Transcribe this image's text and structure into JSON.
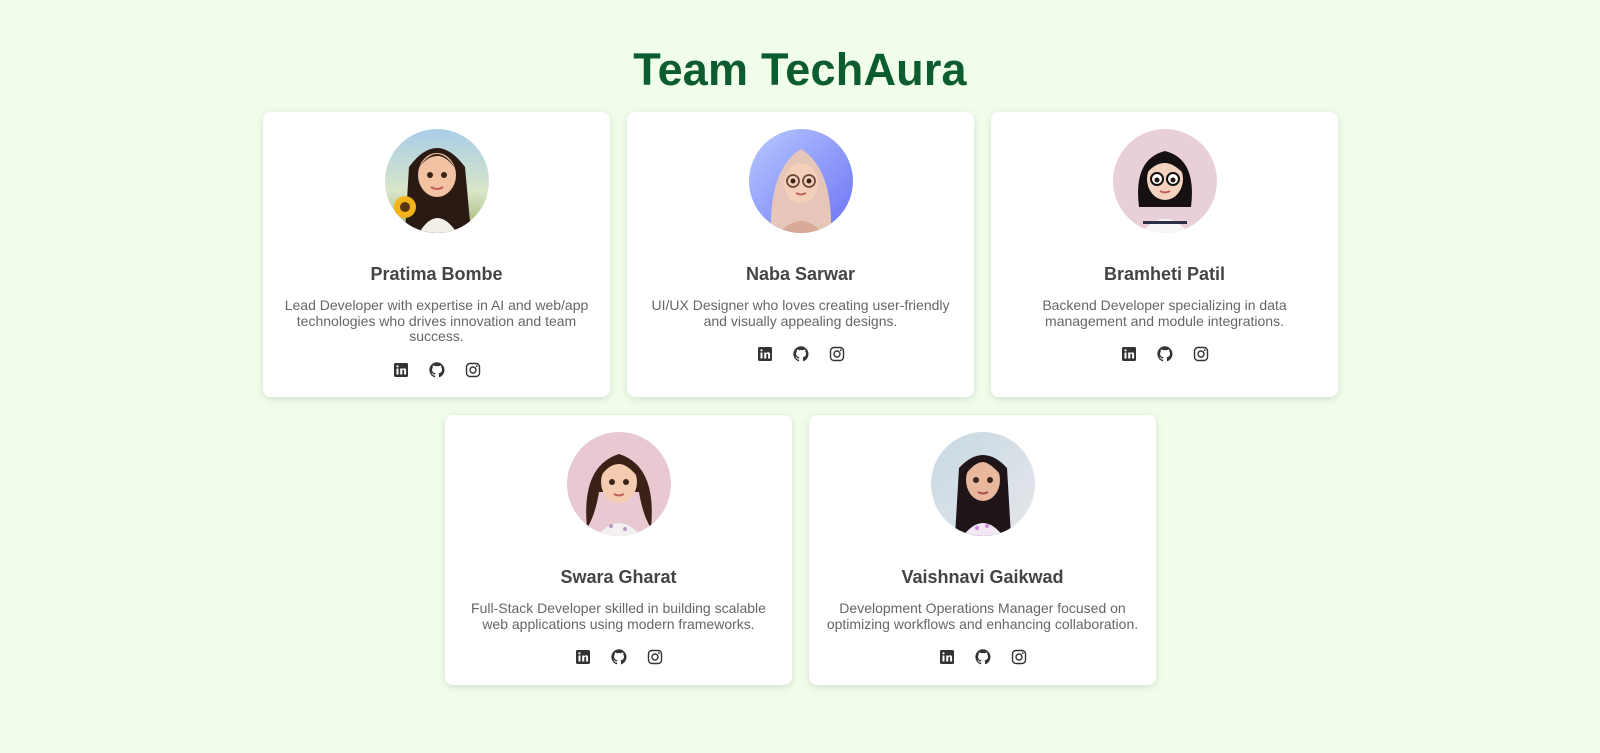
{
  "page": {
    "title": "Team TechAura",
    "title_color": "#0d5c2f",
    "background": "#f0fdea"
  },
  "social_icons": [
    "linkedin-icon",
    "github-icon",
    "instagram-icon"
  ],
  "members": [
    {
      "name": "Pratima Bombe",
      "bio": "Lead Developer with expertise in AI and web/app technologies who drives innovation and team success.",
      "avatar": "avatar-sunflower-girl"
    },
    {
      "name": "Naba Sarwar",
      "bio": "UI/UX Designer who loves creating user-friendly and visually appealing designs.",
      "avatar": "avatar-hijab-girl"
    },
    {
      "name": "Bramheti Patil",
      "bio": "Backend Developer specializing in data management and module integrations.",
      "avatar": "avatar-glasses-girl"
    },
    {
      "name": "Swara Gharat",
      "bio": "Full-Stack Developer skilled in building scalable web applications using modern frameworks.",
      "avatar": "avatar-curly-hair-girl"
    },
    {
      "name": "Vaishnavi Gaikwad",
      "bio": "Development Operations Manager focused on optimizing workflows and enhancing collaboration.",
      "avatar": "avatar-long-hair-girl"
    }
  ]
}
